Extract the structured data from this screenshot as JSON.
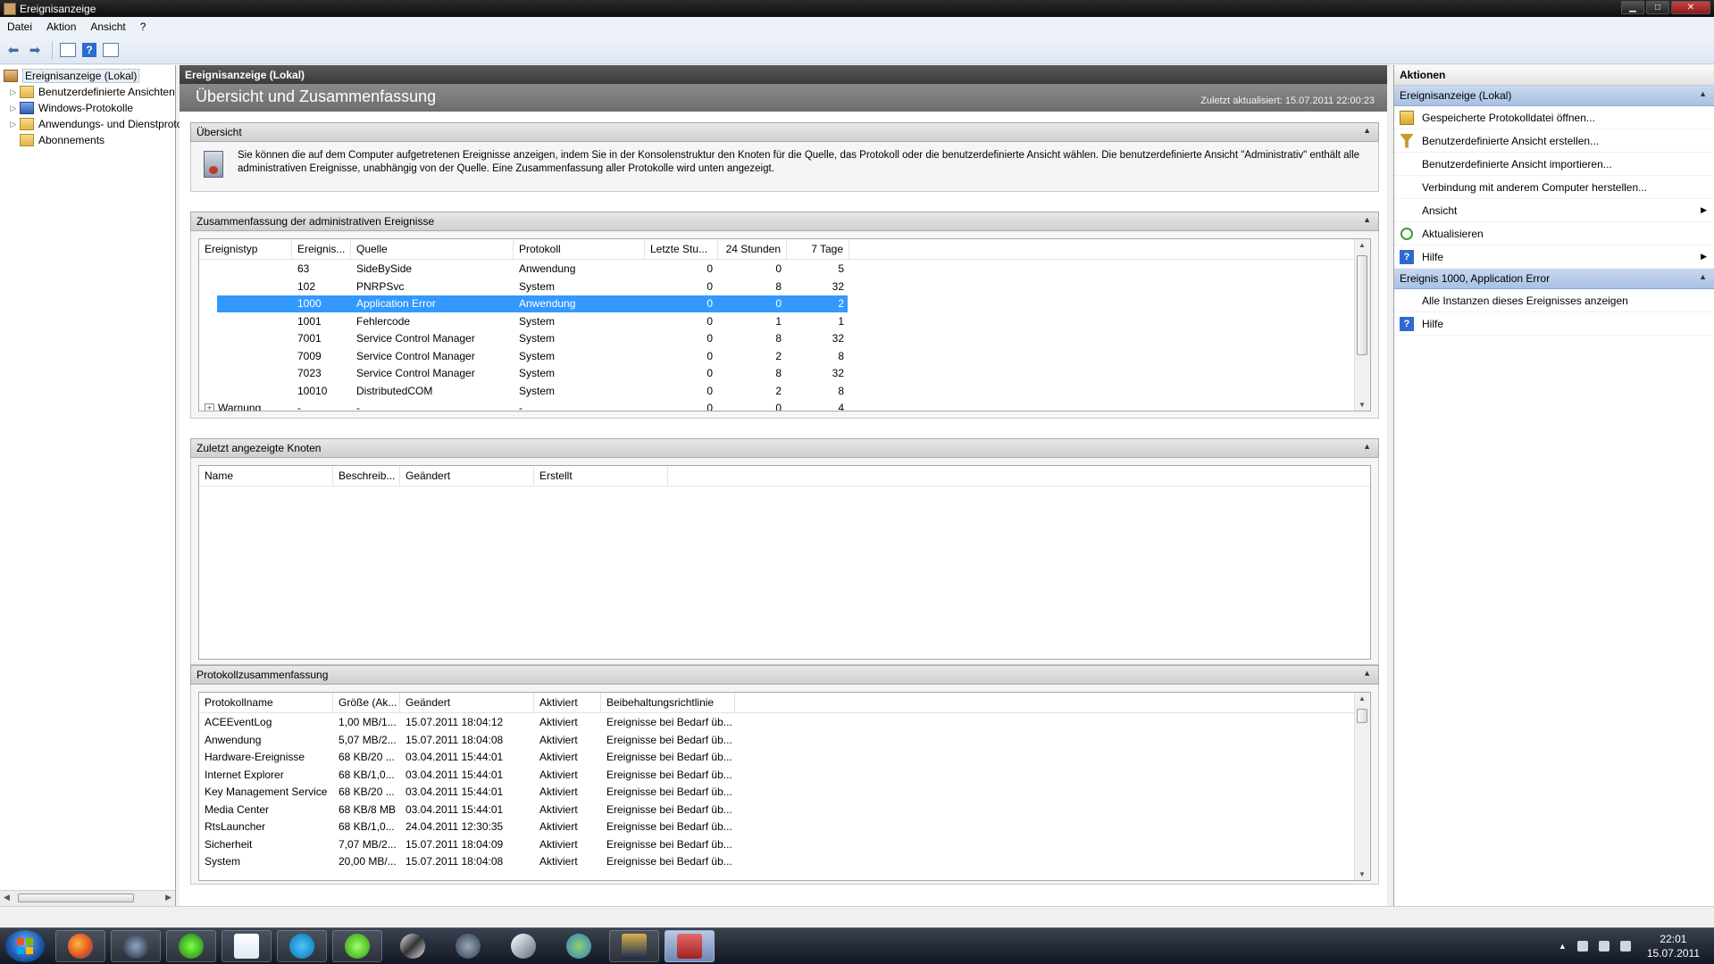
{
  "window": {
    "title": "Ereignisanzeige"
  },
  "menu": [
    "Datei",
    "Aktion",
    "Ansicht",
    "?"
  ],
  "tree": {
    "items": [
      {
        "label": "Ereignisanzeige (Lokal)",
        "icon": "event-viewer-icon",
        "level": 0,
        "selected": true
      },
      {
        "label": "Benutzerdefinierte Ansichten",
        "icon": "folder-icon",
        "level": 1,
        "expandable": true
      },
      {
        "label": "Windows-Protokolle",
        "icon": "windows-logs-icon",
        "level": 1,
        "expandable": true
      },
      {
        "label": "Anwendungs- und Dienstprotokolle",
        "icon": "folder-icon",
        "level": 1,
        "expandable": true
      },
      {
        "label": "Abonnements",
        "icon": "subscriptions-icon",
        "level": 1,
        "expandable": false
      }
    ]
  },
  "center": {
    "header": "Ereignisanzeige (Lokal)",
    "title": "Übersicht und Zusammenfassung",
    "updated": "Zuletzt aktualisiert: 15.07.2011 22:00:23"
  },
  "overview": {
    "title": "Übersicht",
    "text": "Sie können die auf dem Computer aufgetretenen Ereignisse anzeigen, indem Sie in der Konsolenstruktur den Knoten für die Quelle, das Protokoll oder die benutzerdefinierte Ansicht wählen. Die benutzerdefinierte Ansicht \"Administrativ\" enthält alle administrativen Ereignisse, unabhängig von der Quelle. Eine Zusammenfassung aller Protokolle wird unten angezeigt."
  },
  "summary": {
    "title": "Zusammenfassung der administrativen Ereignisse",
    "columns": [
      "Ereignistyp",
      "Ereignis...",
      "Quelle",
      "Protokoll",
      "Letzte Stu...",
      "24 Stunden",
      "7 Tage"
    ],
    "rows": [
      {
        "type": "",
        "id": "63",
        "source": "SideBySide",
        "log": "Anwendung",
        "lasthour": "0",
        "day": "0",
        "week": "5"
      },
      {
        "type": "",
        "id": "102",
        "source": "PNRPSvc",
        "log": "System",
        "lasthour": "0",
        "day": "8",
        "week": "32"
      },
      {
        "type": "",
        "id": "1000",
        "source": "Application Error",
        "log": "Anwendung",
        "lasthour": "0",
        "day": "0",
        "week": "2",
        "selected": true
      },
      {
        "type": "",
        "id": "1001",
        "source": "Fehlercode",
        "log": "System",
        "lasthour": "0",
        "day": "1",
        "week": "1"
      },
      {
        "type": "",
        "id": "7001",
        "source": "Service Control Manager",
        "log": "System",
        "lasthour": "0",
        "day": "8",
        "week": "32"
      },
      {
        "type": "",
        "id": "7009",
        "source": "Service Control Manager",
        "log": "System",
        "lasthour": "0",
        "day": "2",
        "week": "8"
      },
      {
        "type": "",
        "id": "7023",
        "source": "Service Control Manager",
        "log": "System",
        "lasthour": "0",
        "day": "8",
        "week": "32"
      },
      {
        "type": "",
        "id": "10010",
        "source": "DistributedCOM",
        "log": "System",
        "lasthour": "0",
        "day": "2",
        "week": "8"
      },
      {
        "type": "Warnung",
        "id": "-",
        "source": "-",
        "log": "-",
        "lasthour": "0",
        "day": "0",
        "week": "4",
        "expandable": true
      }
    ]
  },
  "recent": {
    "title": "Zuletzt angezeigte Knoten",
    "columns": [
      "Name",
      "Beschreib...",
      "Geändert",
      "Erstellt"
    ]
  },
  "logsummary": {
    "title": "Protokollzusammenfassung",
    "columns": [
      "Protokollname",
      "Größe (Ak...",
      "Geändert",
      "Aktiviert",
      "Beibehaltungsrichtlinie"
    ],
    "rows": [
      {
        "name": "ACEEventLog",
        "size": "1,00 MB/1...",
        "changed": "15.07.2011 18:04:12",
        "enabled": "Aktiviert",
        "policy": "Ereignisse bei Bedarf üb..."
      },
      {
        "name": "Anwendung",
        "size": "5,07 MB/2...",
        "changed": "15.07.2011 18:04:08",
        "enabled": "Aktiviert",
        "policy": "Ereignisse bei Bedarf üb..."
      },
      {
        "name": "Hardware-Ereignisse",
        "size": "68 KB/20 ...",
        "changed": "03.04.2011 15:44:01",
        "enabled": "Aktiviert",
        "policy": "Ereignisse bei Bedarf üb..."
      },
      {
        "name": "Internet Explorer",
        "size": "68 KB/1,0...",
        "changed": "03.04.2011 15:44:01",
        "enabled": "Aktiviert",
        "policy": "Ereignisse bei Bedarf üb..."
      },
      {
        "name": "Key Management Service",
        "size": "68 KB/20 ...",
        "changed": "03.04.2011 15:44:01",
        "enabled": "Aktiviert",
        "policy": "Ereignisse bei Bedarf üb..."
      },
      {
        "name": "Media Center",
        "size": "68 KB/8 MB",
        "changed": "03.04.2011 15:44:01",
        "enabled": "Aktiviert",
        "policy": "Ereignisse bei Bedarf üb..."
      },
      {
        "name": "RtsLauncher",
        "size": "68 KB/1,0...",
        "changed": "24.04.2011 12:30:35",
        "enabled": "Aktiviert",
        "policy": "Ereignisse bei Bedarf üb..."
      },
      {
        "name": "Sicherheit",
        "size": "7,07 MB/2...",
        "changed": "15.07.2011 18:04:09",
        "enabled": "Aktiviert",
        "policy": "Ereignisse bei Bedarf üb..."
      },
      {
        "name": "System",
        "size": "20,00 MB/...",
        "changed": "15.07.2011 18:04:08",
        "enabled": "Aktiviert",
        "policy": "Ereignisse bei Bedarf üb..."
      }
    ]
  },
  "actions": {
    "title": "Aktionen",
    "groups": [
      {
        "title": "Ereignisanzeige (Lokal)",
        "items": [
          {
            "label": "Gespeicherte Protokolldatei öffnen...",
            "icon": "open-log-icon"
          },
          {
            "label": "Benutzerdefinierte Ansicht erstellen...",
            "icon": "filter-icon"
          },
          {
            "label": "Benutzerdefinierte Ansicht importieren...",
            "icon": ""
          },
          {
            "label": "Verbindung mit anderem Computer herstellen...",
            "icon": ""
          },
          {
            "label": "Ansicht",
            "icon": "",
            "submenu": true
          },
          {
            "label": "Aktualisieren",
            "icon": "refresh-icon"
          },
          {
            "label": "Hilfe",
            "icon": "help-icon",
            "submenu": true
          }
        ]
      },
      {
        "title": "Ereignis 1000, Application Error",
        "items": [
          {
            "label": "Alle Instanzen dieses Ereignisses anzeigen",
            "icon": ""
          },
          {
            "label": "Hilfe",
            "icon": "help-icon"
          }
        ]
      }
    ]
  },
  "taskbar": {
    "apps": [
      "start-orb",
      "firefox-icon",
      "steam-icon",
      "razer-icon",
      "explorer-window-icon",
      "skype-icon",
      "icq-icon",
      "winamp-icon",
      "steam-client-icon",
      "game-launcher-icon",
      "messenger-icon",
      "league-of-legends-icon",
      "event-viewer-task-icon"
    ],
    "clock_time": "22:01",
    "clock_date": "15.07.2011"
  }
}
